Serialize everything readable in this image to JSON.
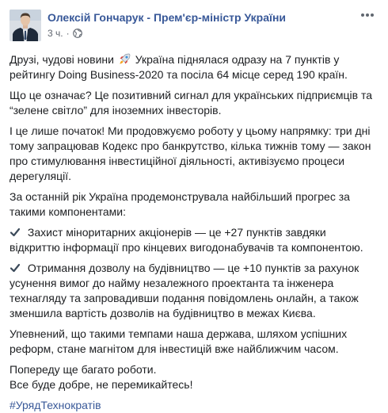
{
  "post": {
    "author": "Олексій Гончарук - Прем'єр-міністр України",
    "time": "3 ч.",
    "separator": "·",
    "icons": {
      "avatar": "avatar",
      "privacy": "globe-icon",
      "menu": "more-options-icon",
      "emoji_rocket": "rocket-icon",
      "emoji_check": "check-icon"
    },
    "colors": {
      "link": "#385898",
      "text": "#1c1e21",
      "meta": "#616770"
    },
    "p1_before": "Друзі, чудові новини",
    "p1_after": "Україна піднялася одразу на 7 пунктів у рейтингу Doing Business-2020 та посіла 64 місце серед 190 країн.",
    "p2": "Що це означає? Це позитивний сигнал для українських підприємців та “зелене світло” для іноземних інвесторів.",
    "p3": "І це лише початок! Ми продовжуємо роботу у цьому напрямку: три дні тому запрацював Кодекс про банкрутство, кілька тижнів тому — закон про стимулювання інвестиційної діяльності, активізуємо процеси дерегуляції.",
    "p4": "За останній рік Україна продемонструвала найбільший прогрес за такими компонентами:",
    "item1": "Захист міноритарних акціонерів — це +27 пунктів завдяки відкриттю інформації про кінцевих вигодонабувачів та компонентою.",
    "item2": "Отримання дозволу на будівництво — це +10 пунктів за рахунок усунення вимог до найму незалежного проектанта та інженера технагляду та запровадивши подання повідомлень онлайн, а також зменшила вартість дозволів на будівництво в межах Києва.",
    "p5": "Упевнений, що такими темпами наша держава, шляхом успішних реформ, стане магнітом для інвестицій вже найближчим часом.",
    "p6_line1": "Попереду ще багато роботи.",
    "p6_line2": "Все буде добре, не перемикайтесь!",
    "hashtag": "#УрядТехнократів"
  }
}
